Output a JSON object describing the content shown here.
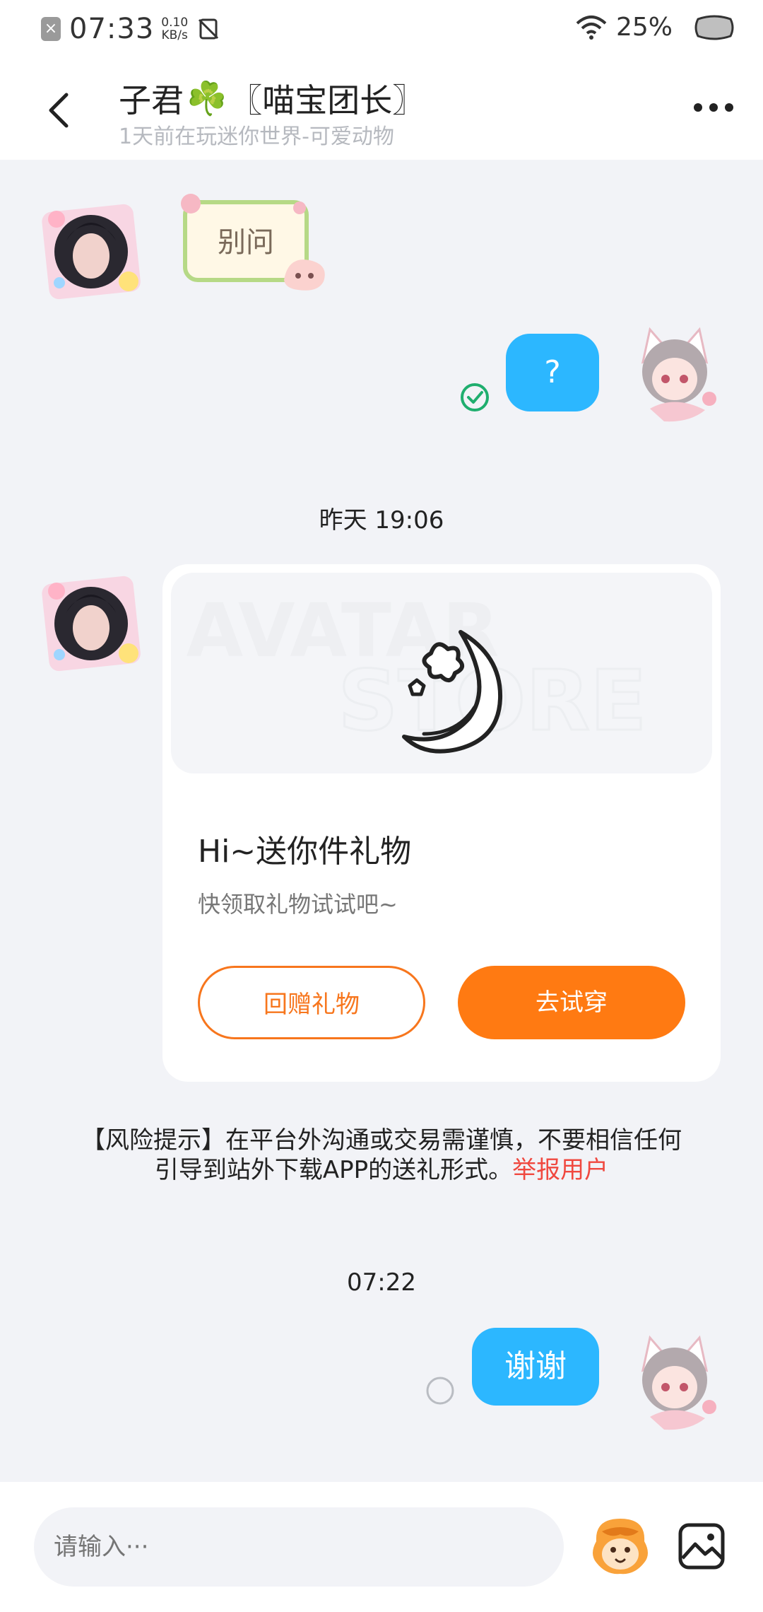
{
  "status_bar": {
    "time": "07:33",
    "speed_value": "0.10",
    "speed_unit": "KB/s",
    "battery": "25%"
  },
  "header": {
    "title_name": "子君",
    "title_emoji": "☘️",
    "title_group": "〖喵宝团长〗",
    "subtitle": "1天前在玩迷你世界-可爱动物"
  },
  "messages": {
    "sticker_text": "别问",
    "msg1": "?",
    "timestamp1": "昨天 19:06",
    "msg2": "谢谢",
    "timestamp2": "07:22"
  },
  "gift_card": {
    "watermark_top": "AVATAR",
    "watermark_bottom": "STORE",
    "title": "Hi~送你件礼物",
    "subtitle": "快领取礼物试试吧~",
    "return_gift_label": "回赠礼物",
    "try_on_label": "去试穿"
  },
  "risk_notice": {
    "text": "【风险提示】在平台外沟通或交易需谨慎，不要相信任何引导到站外下载APP的送礼形式。",
    "report_link": "举报用户"
  },
  "input_bar": {
    "placeholder": "请输入···"
  },
  "colors": {
    "bubble": "#2cb7ff",
    "accent_orange": "#ff7a12",
    "link_red": "#f0483f",
    "background": "#f2f3f7"
  }
}
